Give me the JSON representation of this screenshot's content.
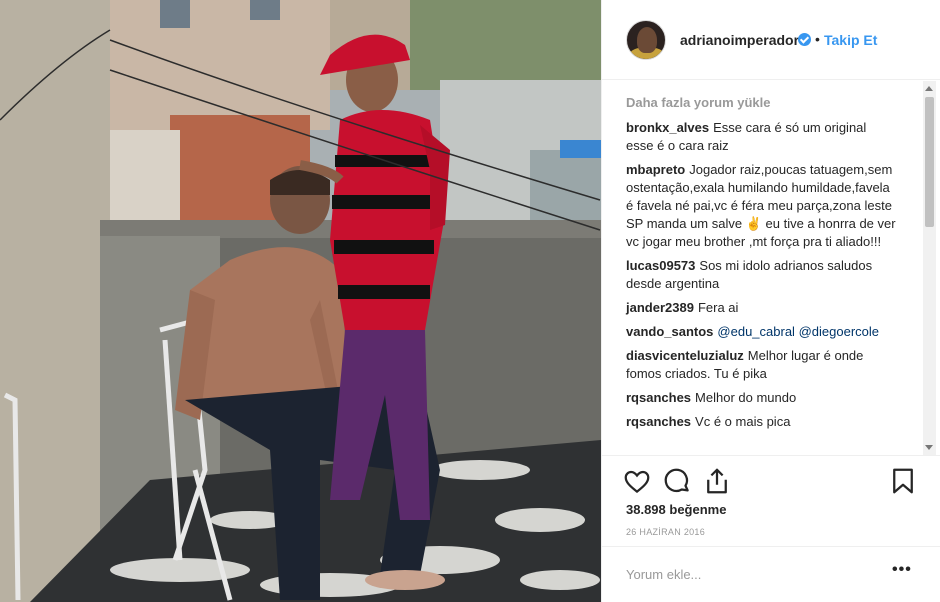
{
  "post": {
    "username": "adrianoimperador",
    "separator": "•",
    "follow_label": "Takip Et",
    "load_more_label": "Daha fazla yorum yükle",
    "comments": [
      {
        "user": "bronkx_alves",
        "text": "Esse cara é só um original esse é o cara raiz"
      },
      {
        "user": "mbapreto",
        "text": "Jogador raiz,poucas tatuagem,sem ostentação,exala humilando humildade,favela é favela né pai,vc é féra meu parça,zona leste SP manda um salve ✌️ eu tive a honrra de ver vc jogar meu brother ,mt força pra ti aliado!!!"
      },
      {
        "user": "lucas09573",
        "text": "Sos mi idolo adrianos saludos desde argentina"
      },
      {
        "user": "jander2389",
        "text": "Fera ai"
      },
      {
        "user": "vando_santos",
        "mention1": "@edu_cabral",
        "mention2": "@diegoercole"
      },
      {
        "user": "diasvicenteluzialuz",
        "text": "Melhor lugar é onde fomos criados. Tu é pika"
      },
      {
        "user": "rqsanches",
        "text": "Melhor do mundo"
      },
      {
        "user": "rqsanches",
        "text": "Vc é o mais pica"
      }
    ],
    "likes_label": "38.898 beğenme",
    "date_label": "26 HAZİRAN 2016",
    "comment_placeholder": "Yorum ekle...",
    "more_label": "•••"
  },
  "icons": {
    "verified": "verified-badge-icon",
    "like": "heart-icon",
    "comment": "comment-bubble-icon",
    "share": "share-icon",
    "save": "bookmark-icon"
  },
  "colors": {
    "accent": "#3897f0",
    "text": "#262626",
    "muted": "#999999",
    "border": "#efefef"
  }
}
